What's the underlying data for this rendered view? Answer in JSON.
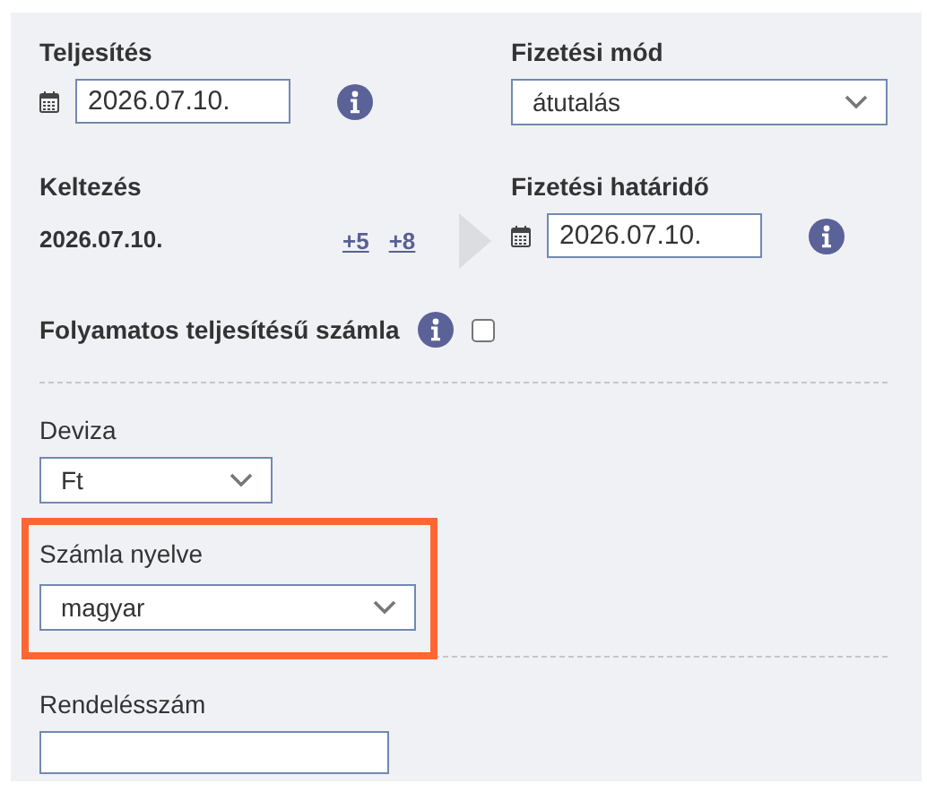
{
  "teljesites": {
    "label": "Teljesítés",
    "value": "2026.07.10."
  },
  "fizetesi_mod": {
    "label": "Fizetési mód",
    "value": "átutalás"
  },
  "keltezes": {
    "label": "Keltezés",
    "value": "2026.07.10.",
    "links": [
      "+5",
      "+8"
    ]
  },
  "fizetesi_hatarido": {
    "label": "Fizetési határidő",
    "value": "2026.07.10."
  },
  "folyamatos": {
    "label": "Folyamatos teljesítésű számla",
    "checked": false
  },
  "deviza": {
    "label": "Deviza",
    "value": "Ft"
  },
  "szamla_nyelve": {
    "label": "Számla nyelve",
    "value": "magyar",
    "highlighted": true
  },
  "rendelesszam": {
    "label": "Rendelésszám"
  }
}
